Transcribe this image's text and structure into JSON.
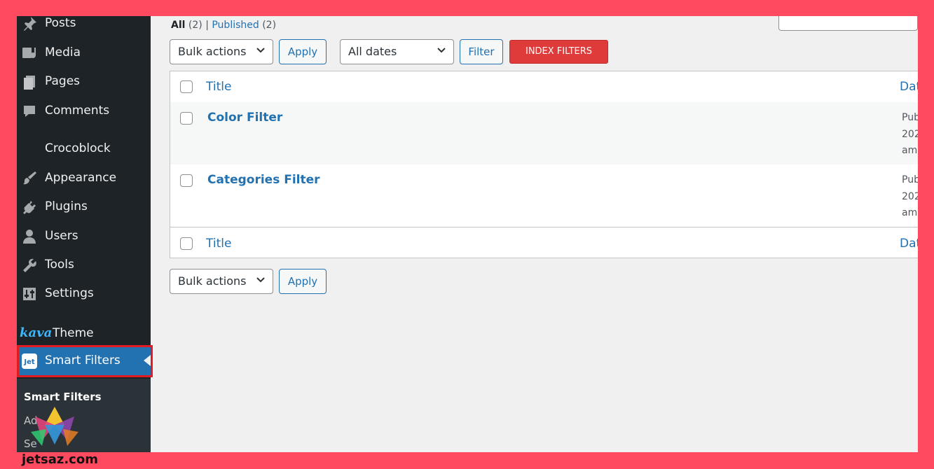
{
  "sidebar": {
    "items": [
      {
        "label": "Posts",
        "icon": "pin-icon"
      },
      {
        "label": "Media",
        "icon": "media-icon"
      },
      {
        "label": "Pages",
        "icon": "pages-icon"
      },
      {
        "label": "Comments",
        "icon": "comment-icon"
      },
      {
        "label": "Crocoblock",
        "icon": "crocoblock-icon"
      },
      {
        "label": "Appearance",
        "icon": "brush-icon"
      },
      {
        "label": "Plugins",
        "icon": "plug-icon"
      },
      {
        "label": "Users",
        "icon": "user-icon"
      },
      {
        "label": "Tools",
        "icon": "wrench-icon"
      },
      {
        "label": "Settings",
        "icon": "settings-icon"
      }
    ],
    "kava_logo": "kava",
    "theme_label": "Theme",
    "active_item": {
      "label": "Smart Filters",
      "icon": "jet-icon"
    },
    "submenu": [
      {
        "label": "Smart Filters"
      },
      {
        "label": "Ad"
      },
      {
        "label": "Se"
      }
    ]
  },
  "views": {
    "all_label": "All",
    "all_count": "(2)",
    "separator": "|",
    "published_label": "Published",
    "published_count": "(2)"
  },
  "toolbar_top": {
    "bulk_actions": "Bulk actions",
    "apply": "Apply",
    "dates": "All dates",
    "filter": "Filter",
    "index_filters": "INDEX FILTERS"
  },
  "table": {
    "col_title": "Title",
    "col_date": "Dat",
    "rows": [
      {
        "title": "Color Filter",
        "date_lines": [
          "Pub",
          "202",
          "am"
        ]
      },
      {
        "title": "Categories Filter",
        "date_lines": [
          "Pub",
          "202",
          "am"
        ]
      }
    ]
  },
  "toolbar_bottom": {
    "bulk_actions": "Bulk actions",
    "apply": "Apply"
  },
  "watermark": "jetsaz.com",
  "colors": {
    "frame_border": "#ff4a5f",
    "sidebar_bg": "#1d2327",
    "accent": "#2271b1",
    "index_button": "#e03b3b",
    "highlight_box": "#e11b22"
  }
}
